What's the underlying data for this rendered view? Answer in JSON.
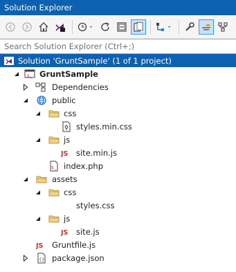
{
  "window": {
    "title": "Solution Explorer"
  },
  "toolbar": {
    "icons": [
      "back-icon",
      "forward-icon",
      "home-icon",
      "vs-switch-views-icon",
      "history-icon",
      "refresh-icon",
      "collapse-all-icon",
      "show-all-files-icon",
      "class-view-icon",
      "properties-icon",
      "preview-icon",
      "settings-icon"
    ]
  },
  "search": {
    "placeholder": "Search Solution Explorer (Ctrl+;)"
  },
  "tree": {
    "solution": "Solution 'GruntSample' (1 of 1 project)",
    "project": "GruntSample",
    "dependencies": "Dependencies",
    "public": "public",
    "public_css": "css",
    "styles_min_css": "styles.min.css",
    "public_js": "js",
    "site_min_js": "site.min.js",
    "index_php": "index.php",
    "assets": "assets",
    "assets_css": "css",
    "styles_css": "styles.css",
    "assets_js": "js",
    "site_js": "site.js",
    "gruntfile": "Gruntfile.js",
    "package_json": "package.json"
  },
  "colors": {
    "accent": "#0e60b0",
    "folder": "#dcb67a",
    "js": "#c9332e"
  }
}
